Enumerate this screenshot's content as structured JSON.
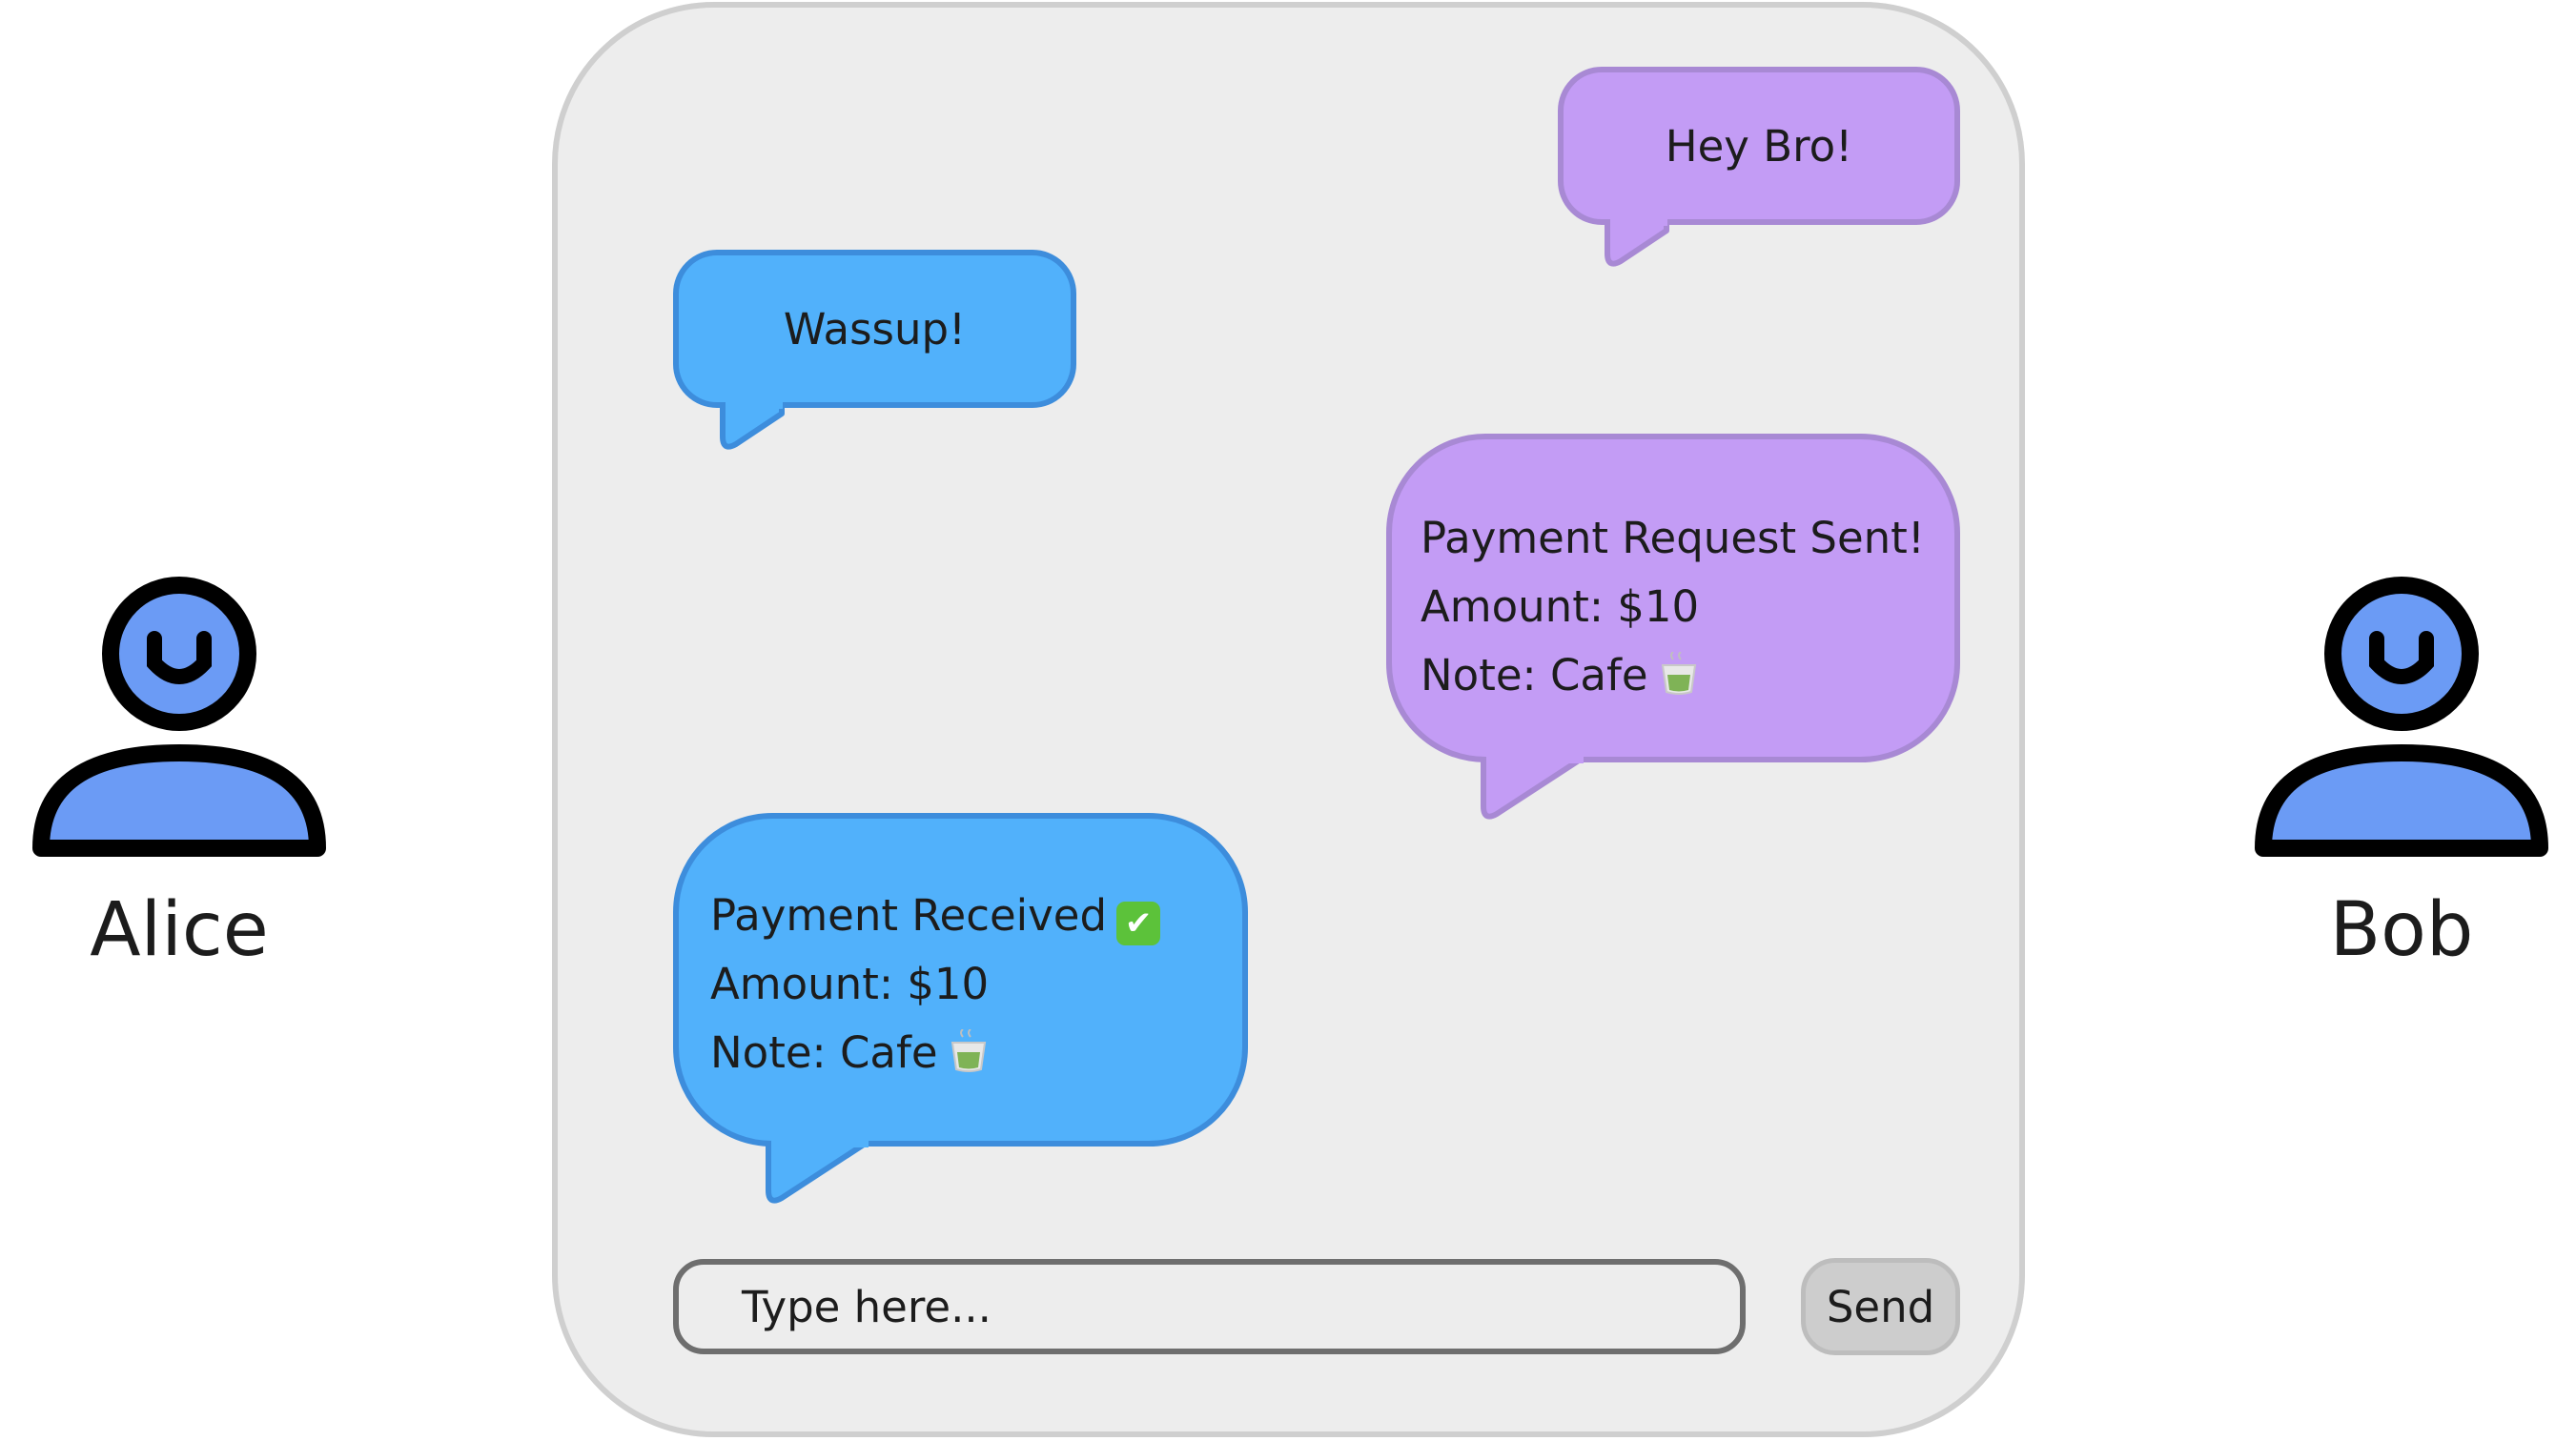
{
  "users": {
    "alice": {
      "name": "Alice",
      "icon": "person-icon"
    },
    "bob": {
      "name": "Bob",
      "icon": "person-icon"
    }
  },
  "colors": {
    "avatar_fill": "#6b9bf5",
    "sent_bubble": "#c39cf5",
    "received_bubble": "#51b1fb",
    "panel_background": "#ededed"
  },
  "messages": [
    {
      "sender": "Bob",
      "text": "Hey Bro!"
    },
    {
      "sender": "Alice",
      "text": "Wassup!"
    },
    {
      "sender": "Bob",
      "lines": [
        "Payment Request Sent!",
        "Amount: $10",
        "Note: Cafe"
      ],
      "note_icon": "tea-cup-icon"
    },
    {
      "sender": "Alice",
      "lines": [
        "Payment Received",
        "Amount: $10",
        "Note: Cafe"
      ],
      "status_icon": "check-mark-icon",
      "note_icon": "tea-cup-icon"
    }
  ],
  "composer": {
    "placeholder": "Type here...",
    "send_label": "Send"
  }
}
